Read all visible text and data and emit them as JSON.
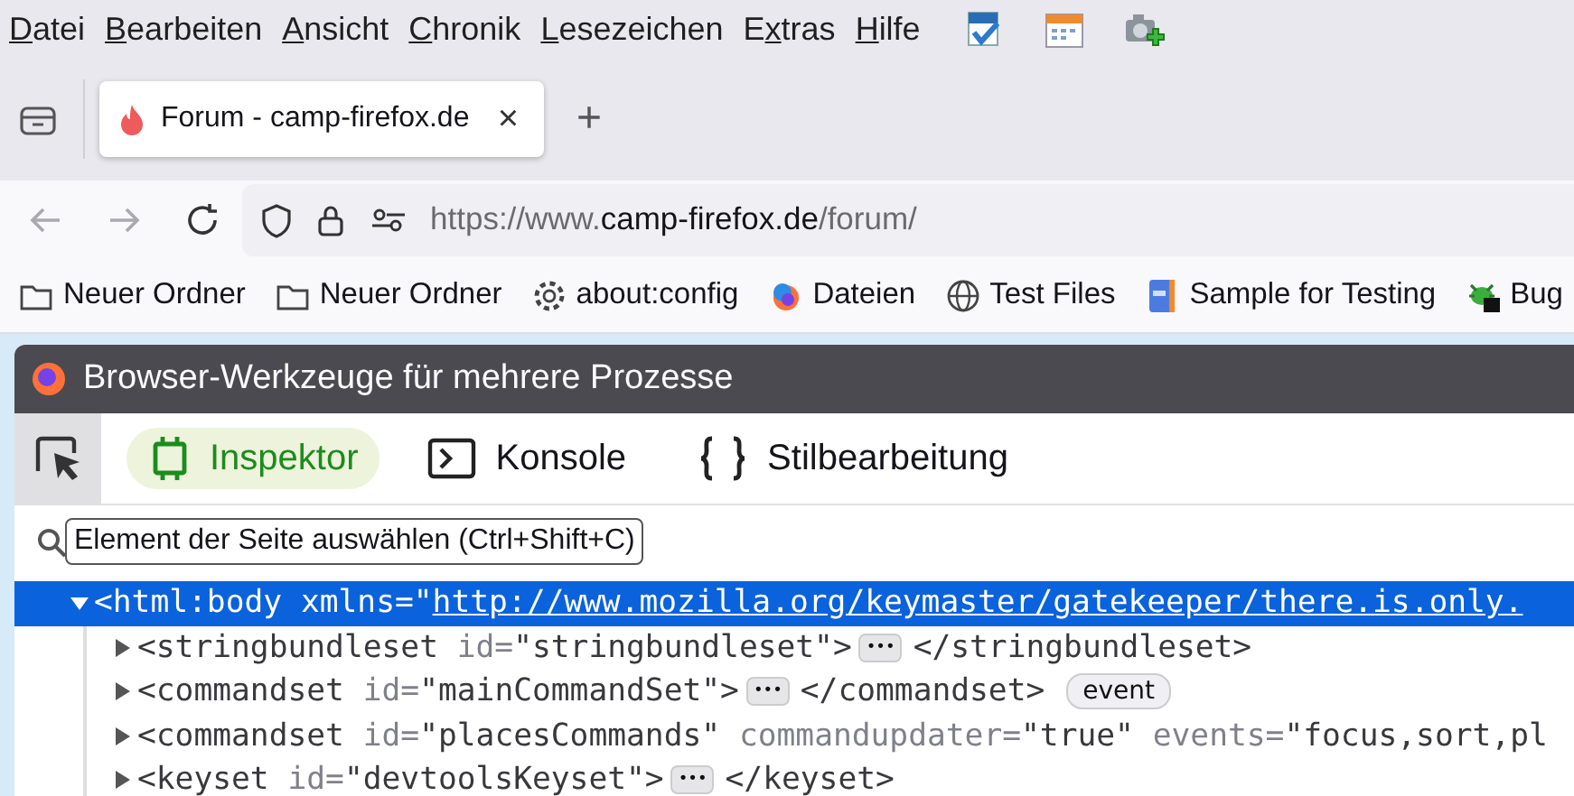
{
  "menu": [
    {
      "key": "D",
      "after": "atei"
    },
    {
      "key": "B",
      "after": "earbeiten"
    },
    {
      "key": "A",
      "after": "nsicht"
    },
    {
      "key": "C",
      "after": "hronik"
    },
    {
      "key": "L",
      "after": "esezeichen"
    },
    {
      "before": "E",
      "key": "x",
      "after": "tras"
    },
    {
      "key": "H",
      "after": "ilfe"
    }
  ],
  "toolbar_icons": [
    {
      "kind": "validator"
    },
    {
      "kind": "calendar"
    },
    {
      "kind": "camera"
    }
  ],
  "tabs": [
    {
      "title": "Forum - camp-firefox.de",
      "selected": true,
      "close": "×"
    }
  ],
  "new_tab": "+",
  "nav": {
    "back_disabled": true,
    "forward_disabled": true,
    "url": {
      "prefix": "https://www.",
      "domain": "camp-firefox.de",
      "path": "/forum/"
    }
  },
  "bookmarks": [
    {
      "kind": "folder",
      "label": "Neuer Ordner"
    },
    {
      "kind": "folder",
      "label": "Neuer Ordner"
    },
    {
      "kind": "gear",
      "label": "about:config"
    },
    {
      "kind": "browser",
      "label": "Dateien"
    },
    {
      "kind": "globe",
      "label": "Test Files"
    },
    {
      "kind": "book",
      "label": "Sample for Testing"
    },
    {
      "kind": "bug",
      "label": "Bug"
    }
  ],
  "devtools": {
    "title": "Browser-Werkzeuge für mehrere Prozesse",
    "tabs": [
      {
        "label": "Inspektor",
        "kind": "inspector",
        "selected": true
      },
      {
        "label": "Konsole",
        "kind": "console",
        "selected": false
      },
      {
        "label": "Stilbearbeitung",
        "kind": "style",
        "selected": false
      }
    ],
    "tooltip": "Element der Seite auswählen (Ctrl+Shift+C)",
    "rows": [
      {
        "selected": true,
        "expanded": true,
        "open": [
          {
            "kind": "tag",
            "text": "<html:body "
          },
          {
            "kind": "attr",
            "text": "xmlns="
          },
          {
            "kind": "value",
            "text": "\""
          },
          {
            "kind": "link",
            "text": "http://www.mozilla.org/keymaster/gatekeeper/there.is.only."
          }
        ]
      },
      {
        "selected": false,
        "expanded": false,
        "open": [
          {
            "kind": "tag",
            "text": "<stringbundleset "
          },
          {
            "kind": "attr",
            "text": "id="
          },
          {
            "kind": "value",
            "text": "\"stringbundleset\""
          },
          {
            "kind": "tag",
            "text": ">"
          }
        ],
        "ellipsis": "•••",
        "close": "</stringbundleset>"
      },
      {
        "selected": false,
        "expanded": false,
        "open": [
          {
            "kind": "tag",
            "text": "<commandset "
          },
          {
            "kind": "attr",
            "text": "id="
          },
          {
            "kind": "value",
            "text": "\"mainCommandSet\""
          },
          {
            "kind": "tag",
            "text": ">"
          }
        ],
        "ellipsis": "•••",
        "close": "</commandset>",
        "badge": "event"
      },
      {
        "selected": false,
        "expanded": false,
        "open": [
          {
            "kind": "tag",
            "text": "<commandset "
          },
          {
            "kind": "attr",
            "text": "id="
          },
          {
            "kind": "value",
            "text": "\"placesCommands\" "
          },
          {
            "kind": "attr",
            "text": "commandupdater="
          },
          {
            "kind": "value",
            "text": "\"true\" "
          },
          {
            "kind": "attr",
            "text": "events="
          },
          {
            "kind": "value",
            "text": "\"focus,sort,pl"
          }
        ]
      },
      {
        "selected": false,
        "expanded": false,
        "open": [
          {
            "kind": "tag",
            "text": "<keyset "
          },
          {
            "kind": "attr",
            "text": "id="
          },
          {
            "kind": "value",
            "text": "\"devtoolsKeyset\""
          },
          {
            "kind": "tag",
            "text": ">"
          }
        ],
        "ellipsis": "•••",
        "close": "</keyset>"
      }
    ]
  }
}
